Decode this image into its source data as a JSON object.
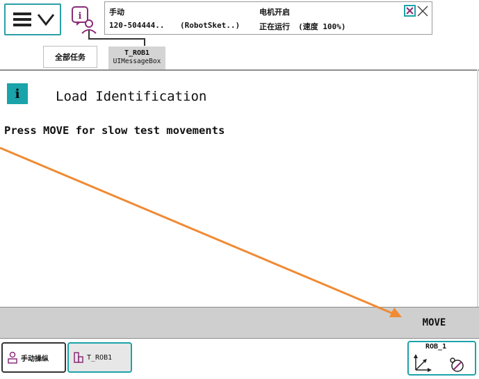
{
  "status": {
    "mode": "手动",
    "controller": "120-504444..",
    "system": "(RobotSket..)",
    "motor_state": "电机开启",
    "run_state": "正在运行",
    "speed": "(速度 100%)"
  },
  "tabs": {
    "all_tasks": "全部任务",
    "current_task": "T_ROB1",
    "current_module": "UIMessageBox"
  },
  "message": {
    "title": "Load Identification",
    "body": "Press MOVE for slow test movements"
  },
  "buttons": {
    "move": "MOVE"
  },
  "taskbar": {
    "jog": "手动操纵",
    "task": "T_ROB1",
    "quickset_robot": "ROB_1"
  },
  "colors": {
    "accent": "#1aa3a9",
    "arrow": "#f08a33",
    "button_bar": "#cfcfcf"
  },
  "icons": {
    "menu": "hamburger-chevron-icon",
    "status": "info-person-icon",
    "close": "close-icon",
    "info": "info-icon",
    "jog": "jog-icon",
    "task": "task-icon",
    "coordinates": "coordinate-axes-icon",
    "increment": "increment-icon"
  }
}
